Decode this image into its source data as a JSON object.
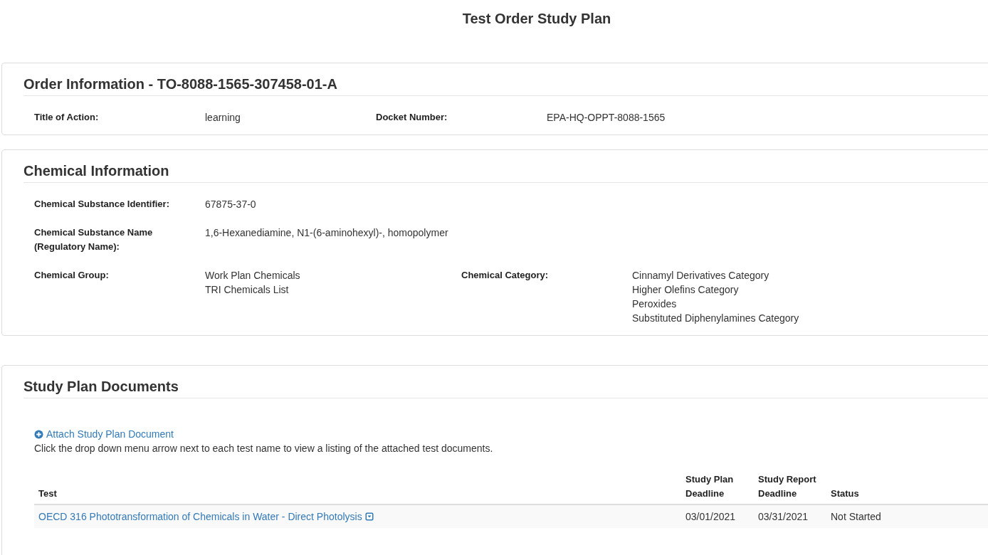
{
  "page_title": "Test Order Study Plan",
  "order_information": {
    "heading": "Order Information - TO-8088-1565-307458-01-A",
    "fields": [
      {
        "label": "Title of Action:",
        "values": [
          "learning"
        ]
      },
      {
        "label": "Docket Number:",
        "values": [
          "EPA-HQ-OPPT-8088-1565"
        ]
      }
    ]
  },
  "chemical_information": {
    "heading": "Chemical Information",
    "rows": [
      [
        {
          "label": "Chemical Substance Identifier:",
          "values": [
            "67875-37-0"
          ]
        }
      ],
      [
        {
          "label": "Chemical Substance Name (Regulatory Name):",
          "values": [
            "1,6-Hexanediamine, N1-(6-aminohexyl)-, homopolymer"
          ]
        }
      ],
      [
        {
          "label": "Chemical Group:",
          "values": [
            "Work Plan Chemicals",
            "TRI Chemicals List"
          ]
        },
        {
          "label": "Chemical Category:",
          "values": [
            "Cinnamyl Derivatives Category",
            "Higher Olefins Category",
            "Peroxides",
            "Substituted Diphenylamines Category"
          ]
        }
      ]
    ]
  },
  "study_plan_documents": {
    "heading": "Study Plan Documents",
    "attach_link": "Attach Study Plan Document",
    "instructions": "Click the drop down menu arrow next to each test name to view a listing of the attached test documents.",
    "table": {
      "columns": [
        "Test",
        "Study Plan Deadline",
        "Study Report Deadline",
        "Status"
      ],
      "rows": [
        {
          "test": "OECD 316 Phototransformation of Chemicals in Water - Direct Photolysis",
          "study_plan_deadline": "03/01/2021",
          "study_report_deadline": "03/31/2021",
          "status": "Not Started"
        }
      ]
    }
  }
}
